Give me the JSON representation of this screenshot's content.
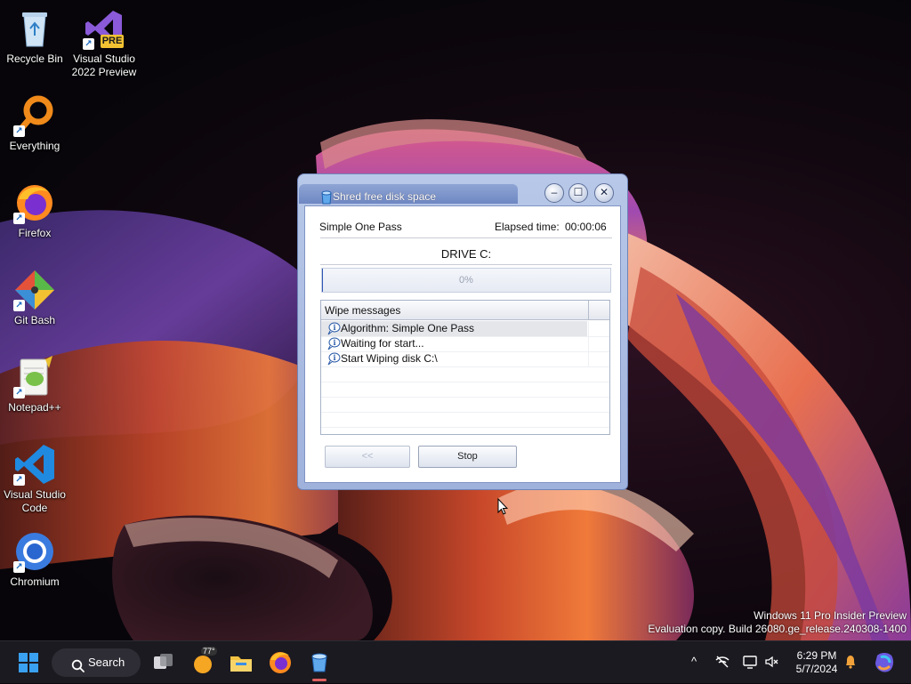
{
  "desktop": {
    "icons": [
      {
        "label": "Recycle Bin",
        "icon": "recycle-bin-icon"
      },
      {
        "label": "Visual Studio 2022 Preview",
        "icon": "visual-studio-preview-icon",
        "badge": "PRE"
      },
      {
        "label": "Everything",
        "icon": "everything-search-icon"
      },
      {
        "label": "Firefox",
        "icon": "firefox-icon"
      },
      {
        "label": "Git Bash",
        "icon": "git-bash-icon"
      },
      {
        "label": "Notepad++",
        "icon": "notepad-plus-plus-icon"
      },
      {
        "label": "Visual Studio Code",
        "icon": "vscode-icon"
      },
      {
        "label": "Chromium",
        "icon": "chromium-icon"
      }
    ]
  },
  "watermark": {
    "line1": "Windows 11 Pro Insider Preview",
    "line2": "Evaluation copy. Build 26080.ge_release.240308-1400"
  },
  "dialog": {
    "title": "Shred free disk space",
    "algorithm": "Simple One Pass",
    "elapsed_label": "Elapsed time:",
    "elapsed_value": "00:00:06",
    "drive": "DRIVE C:",
    "progress_percent": 0,
    "progress_text": "0%",
    "messages_header": "Wipe messages",
    "messages": [
      {
        "text": "Algorithm: Simple One Pass",
        "selected": true
      },
      {
        "text": "Waiting for start...",
        "selected": false
      },
      {
        "text": "Start Wiping disk C:\\",
        "selected": false
      }
    ],
    "back_label": "<<",
    "stop_label": "Stop"
  },
  "taskbar": {
    "search_label": "Search",
    "weather_temp": "77°",
    "time": "6:29 PM",
    "date": "5/7/2024"
  },
  "colors": {
    "taskbar_bg": "#1b1a20",
    "dialog_frame": "#9fb2dc",
    "progress_fill": "#2f56b8"
  }
}
